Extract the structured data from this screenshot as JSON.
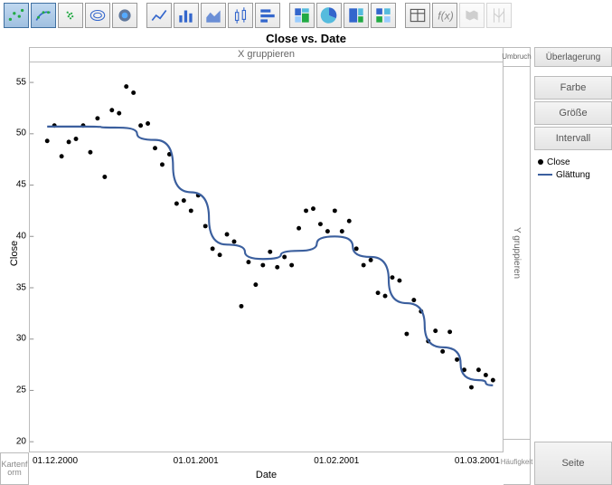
{
  "title": "Close vs. Date",
  "panels": {
    "x_group": "X gruppieren",
    "umbruch": "Umbruch",
    "y_group": "Y gruppieren",
    "hfg": "Häufigkeit",
    "kartenform": "Kartenform"
  },
  "right": {
    "overlay": "Überlagerung",
    "farbe": "Farbe",
    "groesse": "Größe",
    "intervall": "Intervall",
    "seite": "Seite"
  },
  "legend": {
    "points": "Close",
    "smooth": "Glättung"
  },
  "axes": {
    "xlabel": "Date",
    "ylabel": "Close",
    "xticks": [
      "01.12.2000",
      "01.01.2001",
      "01.02.2001",
      "01.03.2001"
    ],
    "yticks": [
      20,
      25,
      30,
      35,
      40,
      45,
      50,
      55
    ]
  },
  "chart_data": {
    "type": "scatter",
    "title": "Close vs. Date",
    "xlabel": "Date",
    "ylabel": "Close",
    "ylim": [
      20,
      56
    ],
    "x_dates": [
      "01.12.2000",
      "01.01.2001",
      "01.02.2001",
      "01.03.2001"
    ],
    "series": [
      {
        "name": "Close",
        "kind": "points",
        "x": [
          0,
          1,
          2,
          3,
          4,
          5,
          6,
          7,
          8,
          9,
          10,
          11,
          12,
          13,
          14,
          15,
          16,
          17,
          18,
          19,
          20,
          21,
          22,
          23,
          24,
          25,
          26,
          27,
          28,
          29,
          30,
          31,
          32,
          33,
          34,
          35,
          36,
          37,
          38,
          39,
          40,
          41,
          42,
          43,
          44,
          45,
          46,
          47,
          48,
          49,
          50,
          51,
          52,
          53,
          54,
          55,
          56,
          57,
          58,
          59,
          60,
          61,
          62
        ],
        "y": [
          49.3,
          50.8,
          47.8,
          49.2,
          49.5,
          50.8,
          48.2,
          51.5,
          45.8,
          52.3,
          52.0,
          54.6,
          54.0,
          50.8,
          51.0,
          48.6,
          47.0,
          48.0,
          43.2,
          43.5,
          42.5,
          44.0,
          41.0,
          38.8,
          38.2,
          40.2,
          39.5,
          33.2,
          37.5,
          35.3,
          37.2,
          38.5,
          37.0,
          38.0,
          37.2,
          40.8,
          42.5,
          42.7,
          41.2,
          40.5,
          42.5,
          40.5,
          41.5,
          38.8,
          37.2,
          37.7,
          34.5,
          34.2,
          36.0,
          35.7,
          30.5,
          33.8,
          32.7,
          29.8,
          30.8,
          28.8,
          30.7,
          28.0,
          27.0,
          25.3,
          27.0,
          26.5,
          26.0
        ]
      },
      {
        "name": "Glättung",
        "kind": "smooth_line",
        "x": [
          0,
          5,
          10,
          15,
          20,
          25,
          30,
          35,
          40,
          45,
          50,
          55,
          60,
          62
        ],
        "y": [
          50.7,
          50.7,
          50.6,
          49.4,
          44.3,
          39.2,
          37.8,
          38.6,
          40.0,
          38.0,
          33.5,
          29.2,
          26.0,
          25.5
        ]
      }
    ]
  }
}
